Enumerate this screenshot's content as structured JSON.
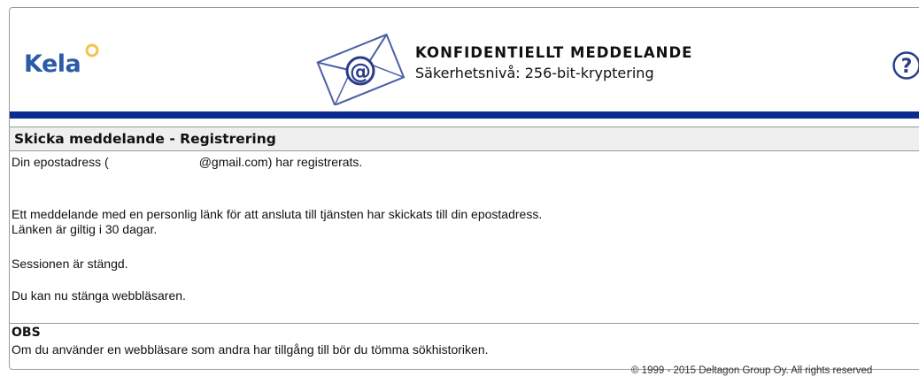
{
  "header": {
    "logo_text": "Kela",
    "title": "KONFIDENTIELLT MEDDELANDE",
    "subtitle": "Säkerhetsnivå: 256-bit-kryptering",
    "help_symbol": "?",
    "envelope_symbol": "@",
    "icons": [
      "kela-logo",
      "envelope-at-icon",
      "help-icon"
    ],
    "colors": {
      "brand_blue": "#2a5aa8",
      "logo_mark": "#f3c34d",
      "header_bar": "#0b2b8f"
    }
  },
  "section": {
    "title": "Skicka meddelande - Registrering"
  },
  "message": {
    "registered_prefix": "Din epostadress (",
    "registered_suffix": "@gmail.com) har registrerats.",
    "link_sent": "Ett meddelande med en personlig länk för att ansluta till tjänsten har skickats till din epostadress.",
    "link_valid": "Länken är giltig i 30 dagar.",
    "session_closed": "Sessionen är stängd.",
    "close_browser": "Du kan nu stänga webbläsaren."
  },
  "obs": {
    "title": "OBS",
    "text": "Om du använder en webbläsare som andra har tillgång till bör du tömma sökhistoriken."
  },
  "footer": {
    "copyright": "© 1999 - 2015 Deltagon Group Oy. All rights reserved"
  }
}
